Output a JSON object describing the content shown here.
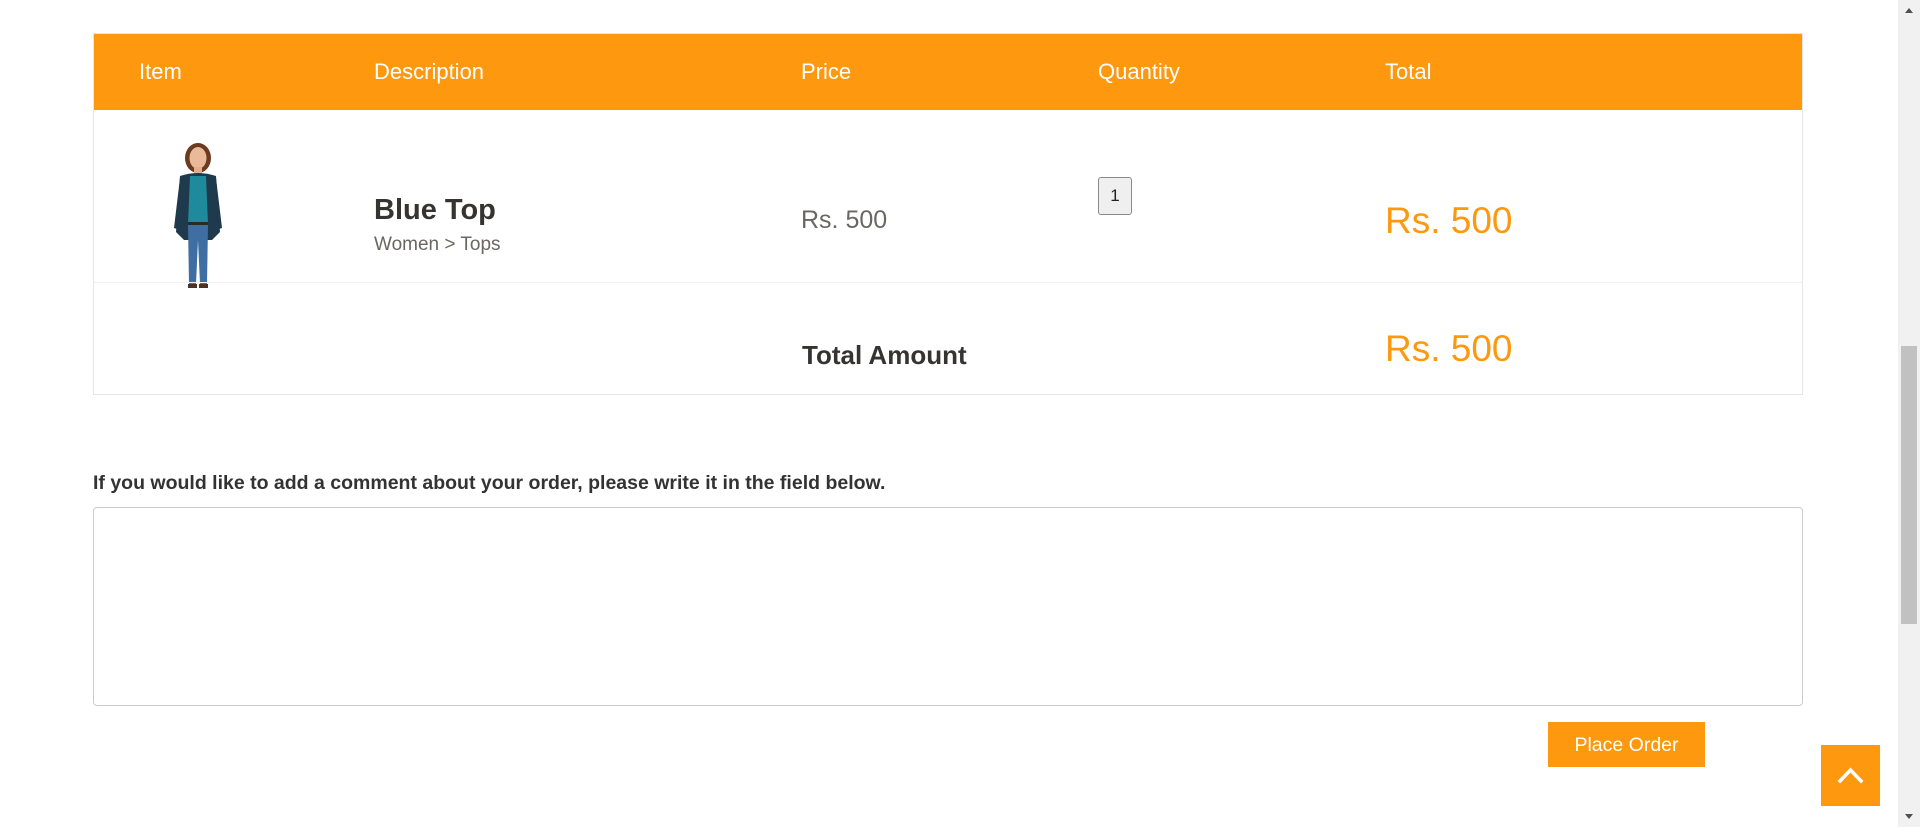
{
  "cart": {
    "columns": [
      "Item",
      "Description",
      "Price",
      "Quantity",
      "Total"
    ],
    "items": [
      {
        "image_icon": "woman-model-photo",
        "name": "Blue Top",
        "category": "Women > Tops",
        "price": "Rs. 500",
        "quantity": "1",
        "total": "Rs. 500"
      }
    ],
    "total_label": "Total Amount",
    "total_amount": "Rs. 500"
  },
  "comment": {
    "label": "If you would like to add a comment about your order, please write it in the field below.",
    "value": ""
  },
  "actions": {
    "place_order_label": "Place Order",
    "scroll_up_icon": "chevron-up-icon"
  },
  "colors": {
    "accent": "#fe980f",
    "text_dark": "#363432",
    "text_muted": "#696763"
  }
}
